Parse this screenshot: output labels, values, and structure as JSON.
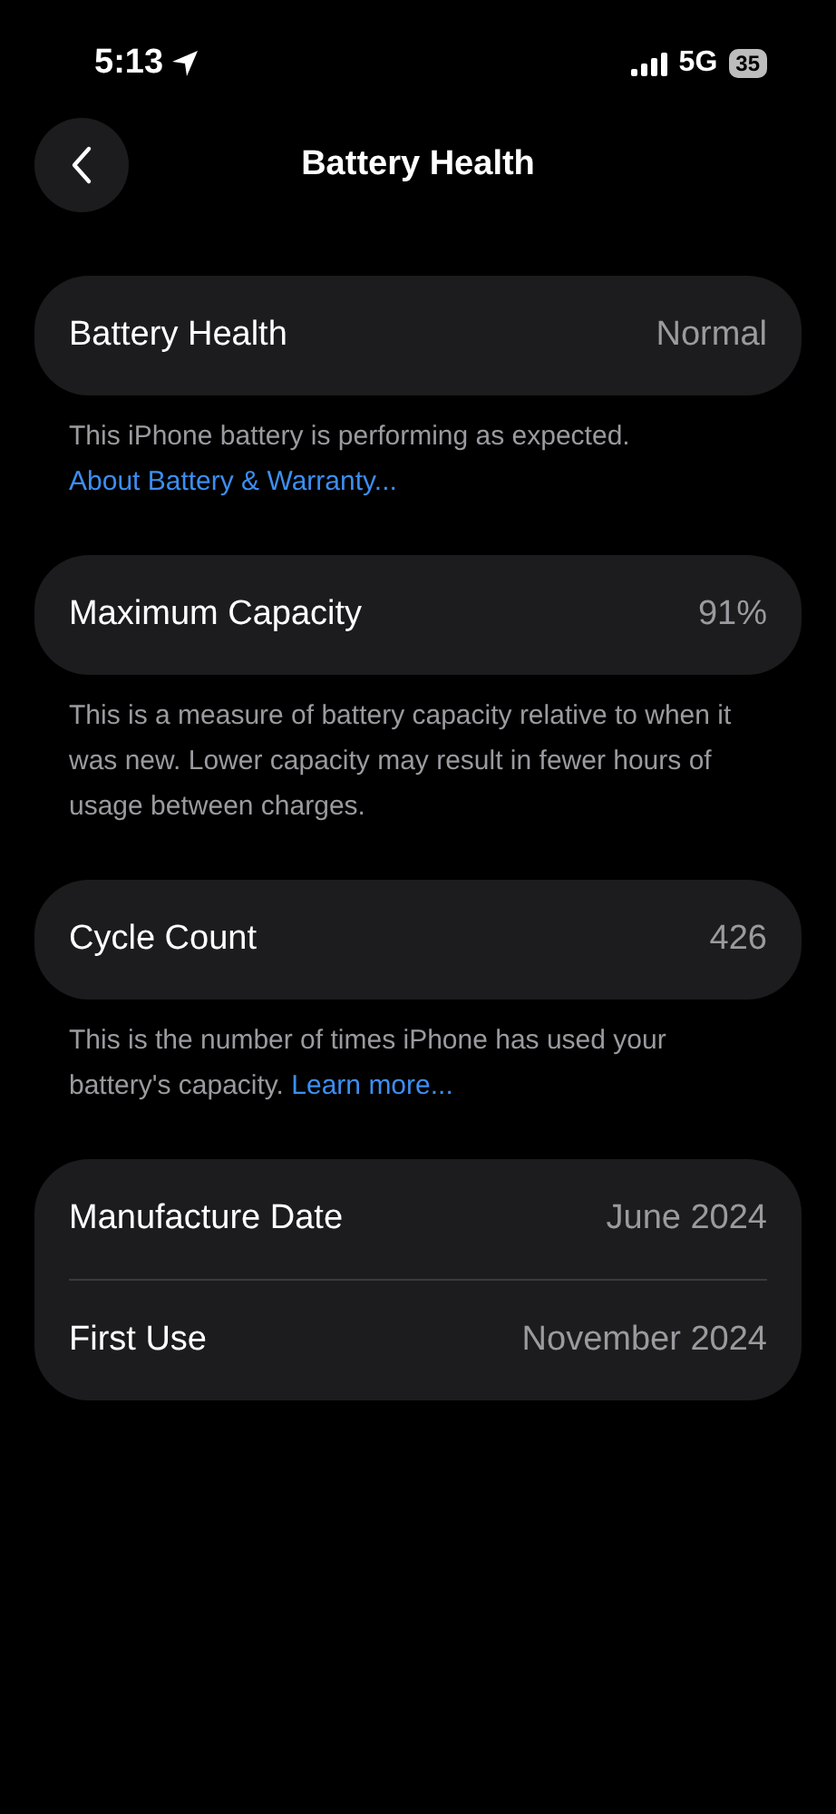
{
  "status_bar": {
    "time": "5:13",
    "network": "5G",
    "battery": "35"
  },
  "nav": {
    "title": "Battery Health"
  },
  "sections": [
    {
      "rows": [
        {
          "label": "Battery Health",
          "value": "Normal"
        }
      ],
      "footer": {
        "text": "This iPhone battery is performing as expected.",
        "link": "About Battery & Warranty..."
      }
    },
    {
      "rows": [
        {
          "label": "Maximum Capacity",
          "value": "91%"
        }
      ],
      "footer": {
        "text": "This is a measure of battery capacity relative to when it was new. Lower capacity may result in fewer hours of usage between charges."
      }
    },
    {
      "rows": [
        {
          "label": "Cycle Count",
          "value": "426"
        }
      ],
      "footer": {
        "text": "This is the number of times iPhone has used your battery's capacity.",
        "link": "Learn more..."
      }
    },
    {
      "rows": [
        {
          "label": "Manufacture Date",
          "value": "June 2024"
        },
        {
          "label": "First Use",
          "value": "November 2024"
        }
      ]
    }
  ]
}
